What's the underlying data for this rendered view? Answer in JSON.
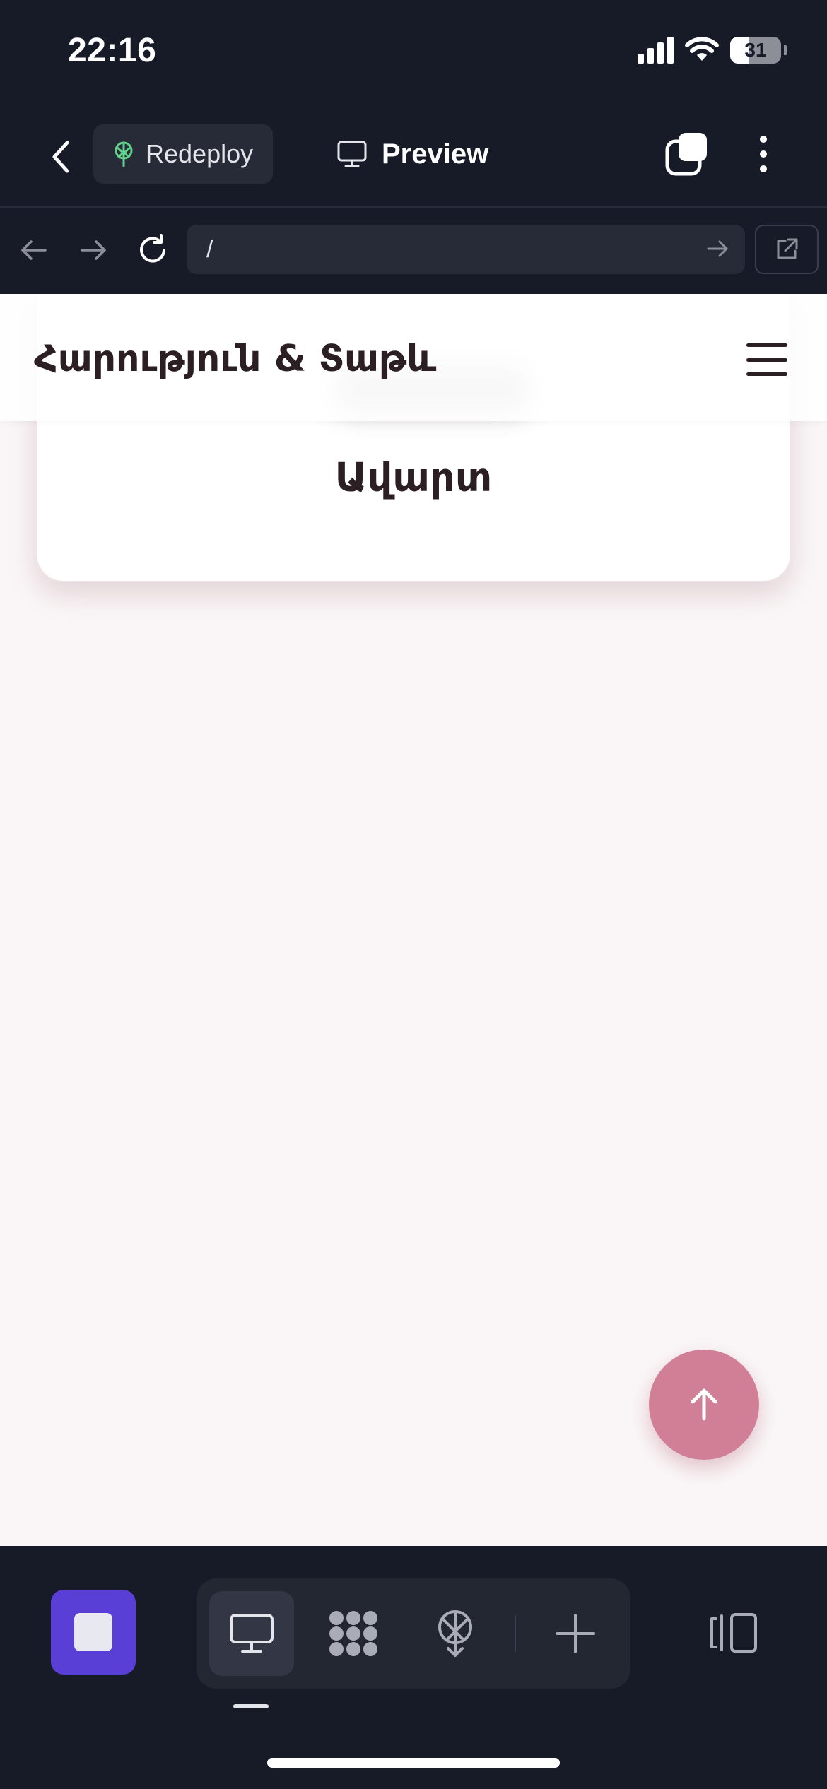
{
  "status_bar": {
    "time": "22:16",
    "battery": "31"
  },
  "header": {
    "redeploy_label": "Redeploy",
    "preview_label": "Preview"
  },
  "browser": {
    "url_value": "/"
  },
  "site": {
    "logo": "Հարություն & Տաթև",
    "card_button": "Ավարտ"
  },
  "colors": {
    "chrome_bg": "#171b28",
    "page_bg": "#faf6f7",
    "accent_pink": "#d07f96",
    "stop_purple": "#5a3fd6",
    "redeploy_green": "#5fd18a"
  },
  "dock": {
    "items": [
      {
        "icon": "monitor-icon"
      },
      {
        "icon": "grid-dots-icon"
      },
      {
        "icon": "deploy-tree-icon"
      },
      {
        "icon": "plus-icon"
      }
    ]
  }
}
